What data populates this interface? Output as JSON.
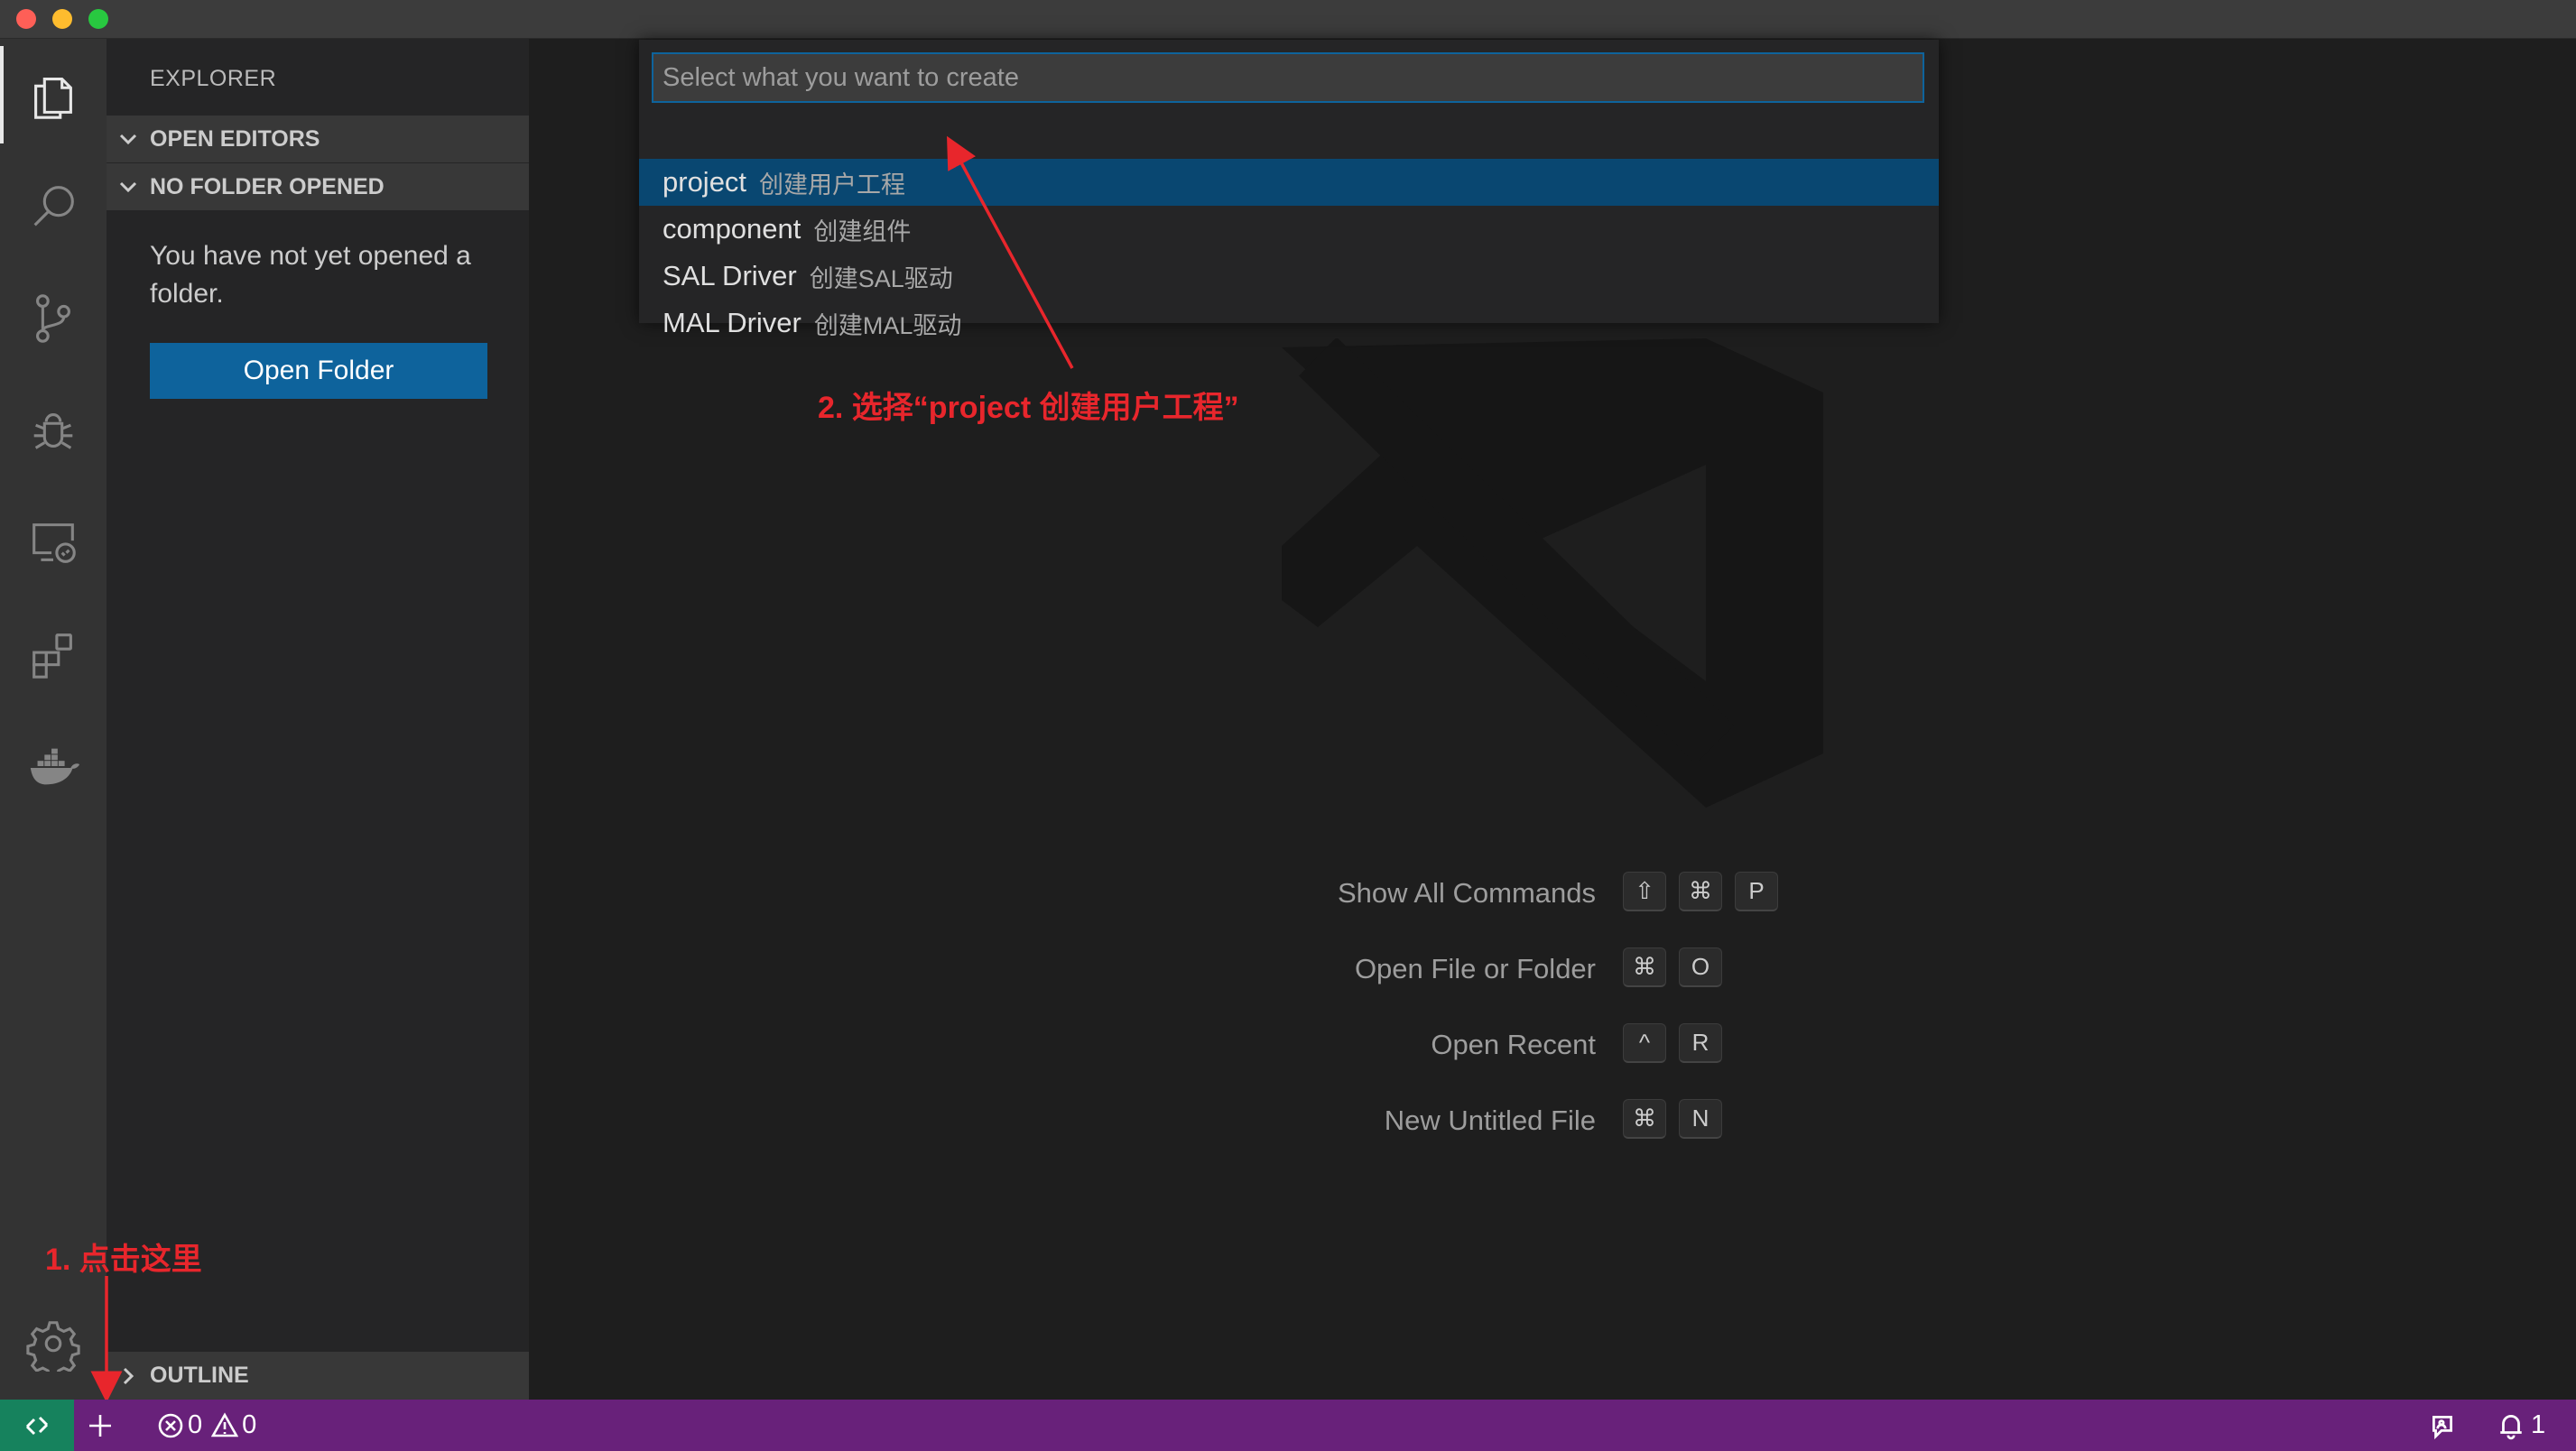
{
  "sidebar": {
    "title": "EXPLORER",
    "sections": {
      "open_editors": "OPEN EDITORS",
      "no_folder": "NO FOLDER OPENED",
      "outline": "OUTLINE"
    },
    "message": "You have not yet opened a folder.",
    "open_folder_label": "Open Folder"
  },
  "activity_bar": {
    "icons": [
      "files-icon",
      "search-icon",
      "source-control-icon",
      "debug-icon",
      "remote-explorer-icon",
      "extensions-icon",
      "docker-icon",
      "settings-gear-icon"
    ]
  },
  "quick_pick": {
    "placeholder": "Select what you want to create",
    "items": [
      {
        "name": "project",
        "desc": "创建用户工程",
        "selected": true
      },
      {
        "name": "component",
        "desc": "创建组件"
      },
      {
        "name": "SAL Driver",
        "desc": "创建SAL驱动"
      },
      {
        "name": "MAL Driver",
        "desc": "创建MAL驱动"
      }
    ]
  },
  "hints": [
    {
      "label": "Show All Commands",
      "keys": [
        "⇧",
        "⌘",
        "P"
      ]
    },
    {
      "label": "Open File or Folder",
      "keys": [
        "⌘",
        "O"
      ]
    },
    {
      "label": "Open Recent",
      "keys": [
        "^",
        "R"
      ]
    },
    {
      "label": "New Untitled File",
      "keys": [
        "⌘",
        "N"
      ]
    }
  ],
  "annotations": {
    "step1": "1. 点击这里",
    "step2": "2. 选择“project 创建用户工程”"
  },
  "status_bar": {
    "errors": "0",
    "warnings": "0",
    "notifications": "1"
  },
  "colors": {
    "status_bar": "#68217a",
    "remote_indicator": "#16825d",
    "selection": "#094771",
    "button": "#0e639c",
    "annotation": "#e8262c"
  }
}
